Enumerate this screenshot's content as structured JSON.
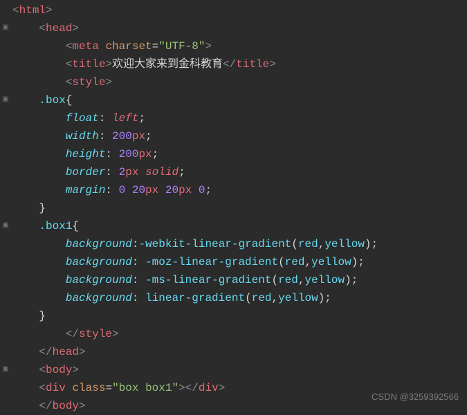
{
  "lines": [
    {
      "indent": 0,
      "parts": [
        {
          "cls": "tag-bracket",
          "t": "<"
        },
        {
          "cls": "tag-name",
          "t": "html"
        },
        {
          "cls": "tag-bracket",
          "t": ">"
        }
      ],
      "fold": false
    },
    {
      "indent": 1,
      "parts": [
        {
          "cls": "tag-bracket",
          "t": "<"
        },
        {
          "cls": "tag-name",
          "t": "head"
        },
        {
          "cls": "tag-bracket",
          "t": ">"
        }
      ],
      "fold": true
    },
    {
      "indent": 2,
      "parts": [
        {
          "cls": "tag-bracket",
          "t": "<"
        },
        {
          "cls": "tag-name",
          "t": "meta"
        },
        {
          "cls": "text-content",
          "t": " "
        },
        {
          "cls": "attr-name",
          "t": "charset"
        },
        {
          "cls": "equals",
          "t": "="
        },
        {
          "cls": "attr-value",
          "t": "\"UTF-8\""
        },
        {
          "cls": "tag-bracket",
          "t": ">"
        }
      ],
      "fold": false
    },
    {
      "indent": 2,
      "parts": [
        {
          "cls": "tag-bracket",
          "t": "<"
        },
        {
          "cls": "tag-name",
          "t": "title"
        },
        {
          "cls": "tag-bracket",
          "t": ">"
        },
        {
          "cls": "text-content",
          "t": "欢迎大家来到金科教育"
        },
        {
          "cls": "tag-bracket",
          "t": "</"
        },
        {
          "cls": "tag-name",
          "t": "title"
        },
        {
          "cls": "tag-bracket",
          "t": ">"
        }
      ],
      "fold": false
    },
    {
      "indent": 2,
      "parts": [
        {
          "cls": "tag-bracket",
          "t": "<"
        },
        {
          "cls": "tag-name",
          "t": "style"
        },
        {
          "cls": "tag-bracket",
          "t": ">"
        }
      ],
      "fold": false
    },
    {
      "indent": 1,
      "parts": [
        {
          "cls": "selector",
          "t": ".box"
        },
        {
          "cls": "selector-brace",
          "t": "{"
        }
      ],
      "fold": true
    },
    {
      "indent": 2,
      "parts": [
        {
          "cls": "property",
          "t": "float"
        },
        {
          "cls": "punct",
          "t": ": "
        },
        {
          "cls": "value-keyword",
          "t": "left"
        },
        {
          "cls": "punct",
          "t": ";"
        }
      ],
      "fold": false
    },
    {
      "indent": 2,
      "parts": [
        {
          "cls": "property",
          "t": "width"
        },
        {
          "cls": "punct",
          "t": ": "
        },
        {
          "cls": "value-num",
          "t": "200"
        },
        {
          "cls": "value-unit",
          "t": "px"
        },
        {
          "cls": "punct",
          "t": ";"
        }
      ],
      "fold": false
    },
    {
      "indent": 2,
      "parts": [
        {
          "cls": "property",
          "t": "height"
        },
        {
          "cls": "punct",
          "t": ": "
        },
        {
          "cls": "value-num",
          "t": "200"
        },
        {
          "cls": "value-unit",
          "t": "px"
        },
        {
          "cls": "punct",
          "t": ";"
        }
      ],
      "fold": false
    },
    {
      "indent": 2,
      "parts": [
        {
          "cls": "property",
          "t": "border"
        },
        {
          "cls": "punct",
          "t": ": "
        },
        {
          "cls": "value-num",
          "t": "2"
        },
        {
          "cls": "value-unit",
          "t": "px"
        },
        {
          "cls": "punct",
          "t": " "
        },
        {
          "cls": "value-keyword",
          "t": "solid"
        },
        {
          "cls": "punct",
          "t": ";"
        }
      ],
      "fold": false
    },
    {
      "indent": 2,
      "parts": [
        {
          "cls": "property",
          "t": "margin"
        },
        {
          "cls": "punct",
          "t": ": "
        },
        {
          "cls": "value-num",
          "t": "0"
        },
        {
          "cls": "punct",
          "t": " "
        },
        {
          "cls": "value-num",
          "t": "20"
        },
        {
          "cls": "value-unit",
          "t": "px"
        },
        {
          "cls": "punct",
          "t": " "
        },
        {
          "cls": "value-num",
          "t": "20"
        },
        {
          "cls": "value-unit",
          "t": "px"
        },
        {
          "cls": "punct",
          "t": " "
        },
        {
          "cls": "value-num",
          "t": "0"
        },
        {
          "cls": "punct",
          "t": ";"
        }
      ],
      "fold": false
    },
    {
      "indent": 1,
      "parts": [
        {
          "cls": "selector-brace",
          "t": "}"
        }
      ],
      "fold": false
    },
    {
      "indent": 1,
      "parts": [
        {
          "cls": "selector",
          "t": ".box1"
        },
        {
          "cls": "selector-brace",
          "t": "{"
        }
      ],
      "fold": true
    },
    {
      "indent": 2,
      "parts": [
        {
          "cls": "property",
          "t": "background"
        },
        {
          "cls": "punct",
          "t": ":"
        },
        {
          "cls": "value-func",
          "t": "-webkit-linear-gradient"
        },
        {
          "cls": "punct",
          "t": "("
        },
        {
          "cls": "value-color",
          "t": "red"
        },
        {
          "cls": "punct",
          "t": ","
        },
        {
          "cls": "value-color",
          "t": "yellow"
        },
        {
          "cls": "punct",
          "t": ");"
        }
      ],
      "fold": false
    },
    {
      "indent": 2,
      "parts": [
        {
          "cls": "property",
          "t": "background"
        },
        {
          "cls": "punct",
          "t": ": "
        },
        {
          "cls": "value-func",
          "t": "-moz-linear-gradient"
        },
        {
          "cls": "punct",
          "t": "("
        },
        {
          "cls": "value-color",
          "t": "red"
        },
        {
          "cls": "punct",
          "t": ","
        },
        {
          "cls": "value-color",
          "t": "yellow"
        },
        {
          "cls": "punct",
          "t": ");"
        }
      ],
      "fold": false
    },
    {
      "indent": 2,
      "parts": [
        {
          "cls": "property",
          "t": "background"
        },
        {
          "cls": "punct",
          "t": ": "
        },
        {
          "cls": "value-func",
          "t": "-ms-linear-gradient"
        },
        {
          "cls": "punct",
          "t": "("
        },
        {
          "cls": "value-color",
          "t": "red"
        },
        {
          "cls": "punct",
          "t": ","
        },
        {
          "cls": "value-color",
          "t": "yellow"
        },
        {
          "cls": "punct",
          "t": ");"
        }
      ],
      "fold": false
    },
    {
      "indent": 2,
      "parts": [
        {
          "cls": "property",
          "t": "background"
        },
        {
          "cls": "punct",
          "t": ": "
        },
        {
          "cls": "value-func",
          "t": "linear-gradient"
        },
        {
          "cls": "punct",
          "t": "("
        },
        {
          "cls": "value-color",
          "t": "red"
        },
        {
          "cls": "punct",
          "t": ","
        },
        {
          "cls": "value-color",
          "t": "yellow"
        },
        {
          "cls": "punct",
          "t": ");"
        }
      ],
      "fold": false
    },
    {
      "indent": 1,
      "parts": [
        {
          "cls": "selector-brace",
          "t": "}"
        }
      ],
      "fold": false
    },
    {
      "indent": 2,
      "parts": [
        {
          "cls": "tag-bracket",
          "t": "</"
        },
        {
          "cls": "tag-name",
          "t": "style"
        },
        {
          "cls": "tag-bracket",
          "t": ">"
        }
      ],
      "fold": false
    },
    {
      "indent": 1,
      "parts": [
        {
          "cls": "tag-bracket",
          "t": "</"
        },
        {
          "cls": "tag-name",
          "t": "head"
        },
        {
          "cls": "tag-bracket",
          "t": ">"
        }
      ],
      "fold": false
    },
    {
      "indent": 1,
      "parts": [
        {
          "cls": "tag-bracket",
          "t": "<"
        },
        {
          "cls": "tag-name",
          "t": "body"
        },
        {
          "cls": "tag-bracket",
          "t": ">"
        }
      ],
      "fold": true
    },
    {
      "indent": 1,
      "parts": [
        {
          "cls": "tag-bracket",
          "t": "<"
        },
        {
          "cls": "tag-name",
          "t": "div"
        },
        {
          "cls": "text-content",
          "t": " "
        },
        {
          "cls": "attr-name",
          "t": "class"
        },
        {
          "cls": "equals",
          "t": "="
        },
        {
          "cls": "attr-value",
          "t": "\"box box1\""
        },
        {
          "cls": "tag-bracket",
          "t": "></"
        },
        {
          "cls": "tag-name",
          "t": "div"
        },
        {
          "cls": "tag-bracket",
          "t": ">"
        }
      ],
      "fold": false
    },
    {
      "indent": 1,
      "parts": [
        {
          "cls": "tag-bracket",
          "t": "</"
        },
        {
          "cls": "tag-name",
          "t": "body"
        },
        {
          "cls": "tag-bracket",
          "t": ">"
        }
      ],
      "fold": false
    }
  ],
  "indent_unit": "    ",
  "watermark": "CSDN @3259392566"
}
